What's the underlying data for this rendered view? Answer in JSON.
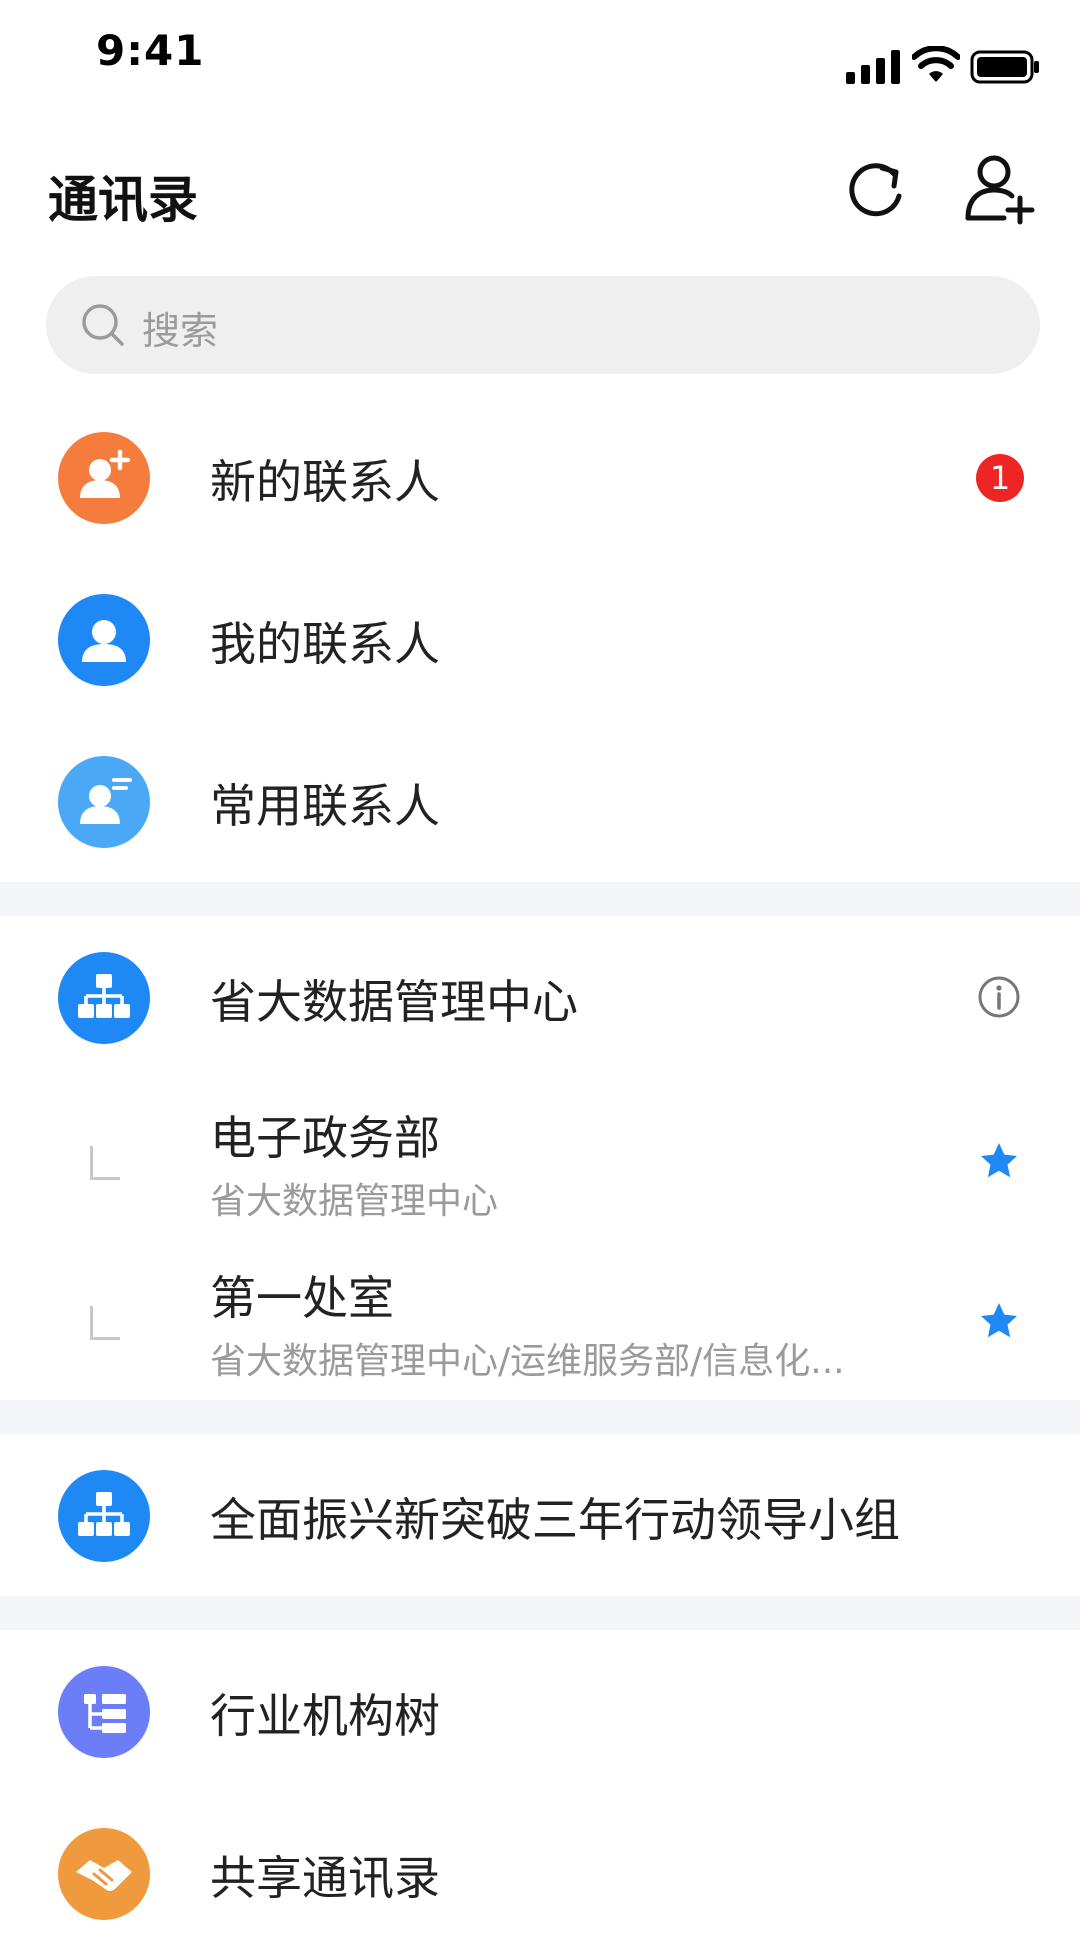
{
  "status_bar": {
    "time": "9:41"
  },
  "header": {
    "title": "通讯录"
  },
  "search": {
    "placeholder": "搜索"
  },
  "contacts_section": [
    {
      "label": "新的联系人",
      "icon": "new-contact-icon",
      "color": "#f47c3c",
      "badge": "1"
    },
    {
      "label": "我的联系人",
      "icon": "person-icon",
      "color": "#1e88f5"
    },
    {
      "label": "常用联系人",
      "icon": "frequent-contact-icon",
      "color": "#4aa8f7"
    }
  ],
  "org": {
    "label": "省大数据管理中心",
    "icon": "org-chart-icon",
    "color": "#1e88f5",
    "departments": [
      {
        "title": "电子政务部",
        "path": "省大数据管理中心",
        "starred": true
      },
      {
        "title": "第一处室",
        "path": "省大数据管理中心/运维服务部/信息化...",
        "starred": true
      }
    ]
  },
  "group": {
    "label": "全面振兴新突破三年行动领导小组",
    "icon": "org-chart-icon",
    "color": "#1e88f5"
  },
  "more_section": [
    {
      "label": "行业机构树",
      "icon": "tree-list-icon",
      "color": "#6b7ef7"
    },
    {
      "label": "共享通讯录",
      "icon": "handshake-icon",
      "color": "#ef9a3c"
    }
  ],
  "colors": {
    "star": "#1e88f5",
    "badge": "#ee2525",
    "divider": "#f4f5f9"
  }
}
